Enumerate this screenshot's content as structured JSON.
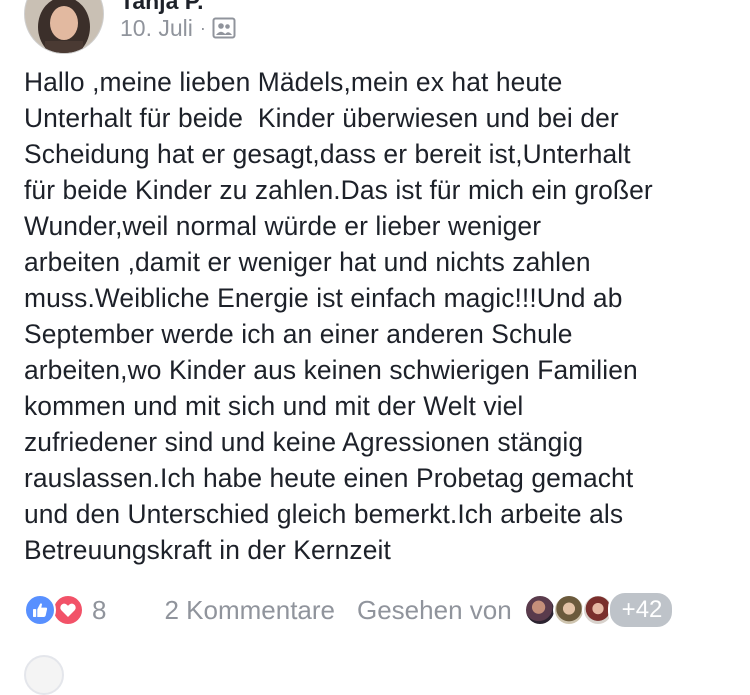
{
  "post": {
    "author": "Tanja P.",
    "date": "10. Juli",
    "separator": "·",
    "audience_icon": "group-icon",
    "text": "Hallo ,meine lieben Mädels,mein ex hat heute\nUnterhalt für beide  Kinder überwiesen und bei der\nScheidung hat er gesagt,dass er bereit ist,Unterhalt\nfür beide Kinder zu zahlen.Das ist für mich ein großer\nWunder,weil normal würde er lieber weniger\narbeiten ,damit er weniger hat und nichts zahlen\nmuss.Weibliche Energie ist einfach magic!!!Und ab\nSeptember werde ich an einer anderen Schule\narbeiten,wo Kinder aus keinen schwierigen Familien\nkommen und mit sich und mit der Welt viel\nzufriedener sind und keine Agressionen stängig\nrauslassen.Ich habe heute einen Probetag gemacht\nund den Unterschied gleich bemerkt.Ich arbeite als\nBetreuungskraft in der Kernzeit"
  },
  "footer": {
    "reaction_icons": [
      "like-icon",
      "love-icon"
    ],
    "reaction_count": "8",
    "comments": "2 Kommentare",
    "seen_by": "Gesehen von",
    "seen_more": "+42"
  },
  "colors": {
    "text": "#1d2129",
    "meta": "#90949c",
    "like": "#5890ff",
    "love": "#f25268",
    "badge": "#bec3c9"
  }
}
